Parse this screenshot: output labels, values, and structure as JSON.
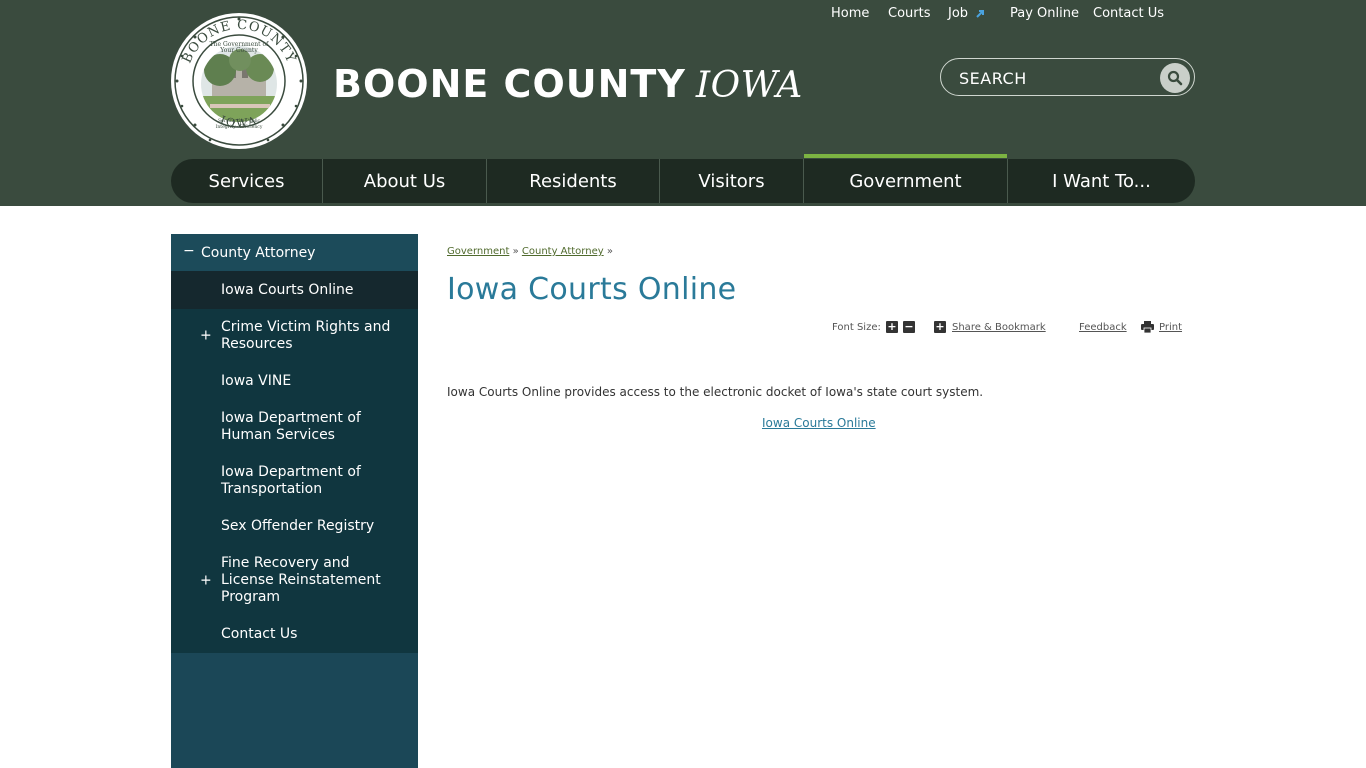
{
  "header": {
    "site_name": "BOONE COUNTY",
    "site_state": "IOWA",
    "seal": {
      "top_text": "BOONE COUNTY",
      "bottom_text": "IOWA",
      "inner_top": "The Government of Your County",
      "inner_bottom": "Serving the Public · Integrity · Efficiency"
    },
    "top_links": [
      {
        "label": "Home"
      },
      {
        "label": "Courts"
      },
      {
        "label": "Job"
      },
      {
        "label": "Pay Online"
      },
      {
        "label": "Contact Us"
      }
    ],
    "search": {
      "placeholder": "SEARCH"
    },
    "nav": [
      {
        "label": "Services"
      },
      {
        "label": "About Us"
      },
      {
        "label": "Residents"
      },
      {
        "label": "Visitors"
      },
      {
        "label": "Government",
        "active": true
      },
      {
        "label": "I Want To..."
      }
    ]
  },
  "sidebar": {
    "heading": "County Attorney",
    "heading_toggle": "−",
    "items": [
      {
        "label": "Iowa Courts Online",
        "current": true
      },
      {
        "label": "Crime Victim Rights and Resources",
        "expand": "+"
      },
      {
        "label": "Iowa VINE"
      },
      {
        "label": "Iowa Department of Human Services"
      },
      {
        "label": "Iowa Department of Transportation"
      },
      {
        "label": "Sex Offender Registry"
      },
      {
        "label": "Fine Recovery and License Reinstatement Program",
        "expand": "+"
      },
      {
        "label": "Contact Us"
      }
    ]
  },
  "content": {
    "breadcrumb": [
      {
        "label": "Government"
      },
      {
        "label": "County Attorney"
      }
    ],
    "breadcrumb_separator": "»",
    "title": "Iowa Courts Online",
    "toolbar": {
      "font_size_label": "Font Size:",
      "increase": "+",
      "decrease": "−",
      "share_icon": "+",
      "share_label": "Share & Bookmark",
      "feedback_label": "Feedback",
      "print_label": "Print"
    },
    "intro": "Iowa Courts Online provides access to the electronic docket of Iowa's state court system.",
    "link_label": "Iowa Courts Online"
  },
  "colors": {
    "header_bg": "#3a4b3e",
    "nav_bg": "#1e2a22",
    "nav_active": "#7cb342",
    "sidebar_bg": "#1b4757",
    "title": "#2a7a99"
  }
}
